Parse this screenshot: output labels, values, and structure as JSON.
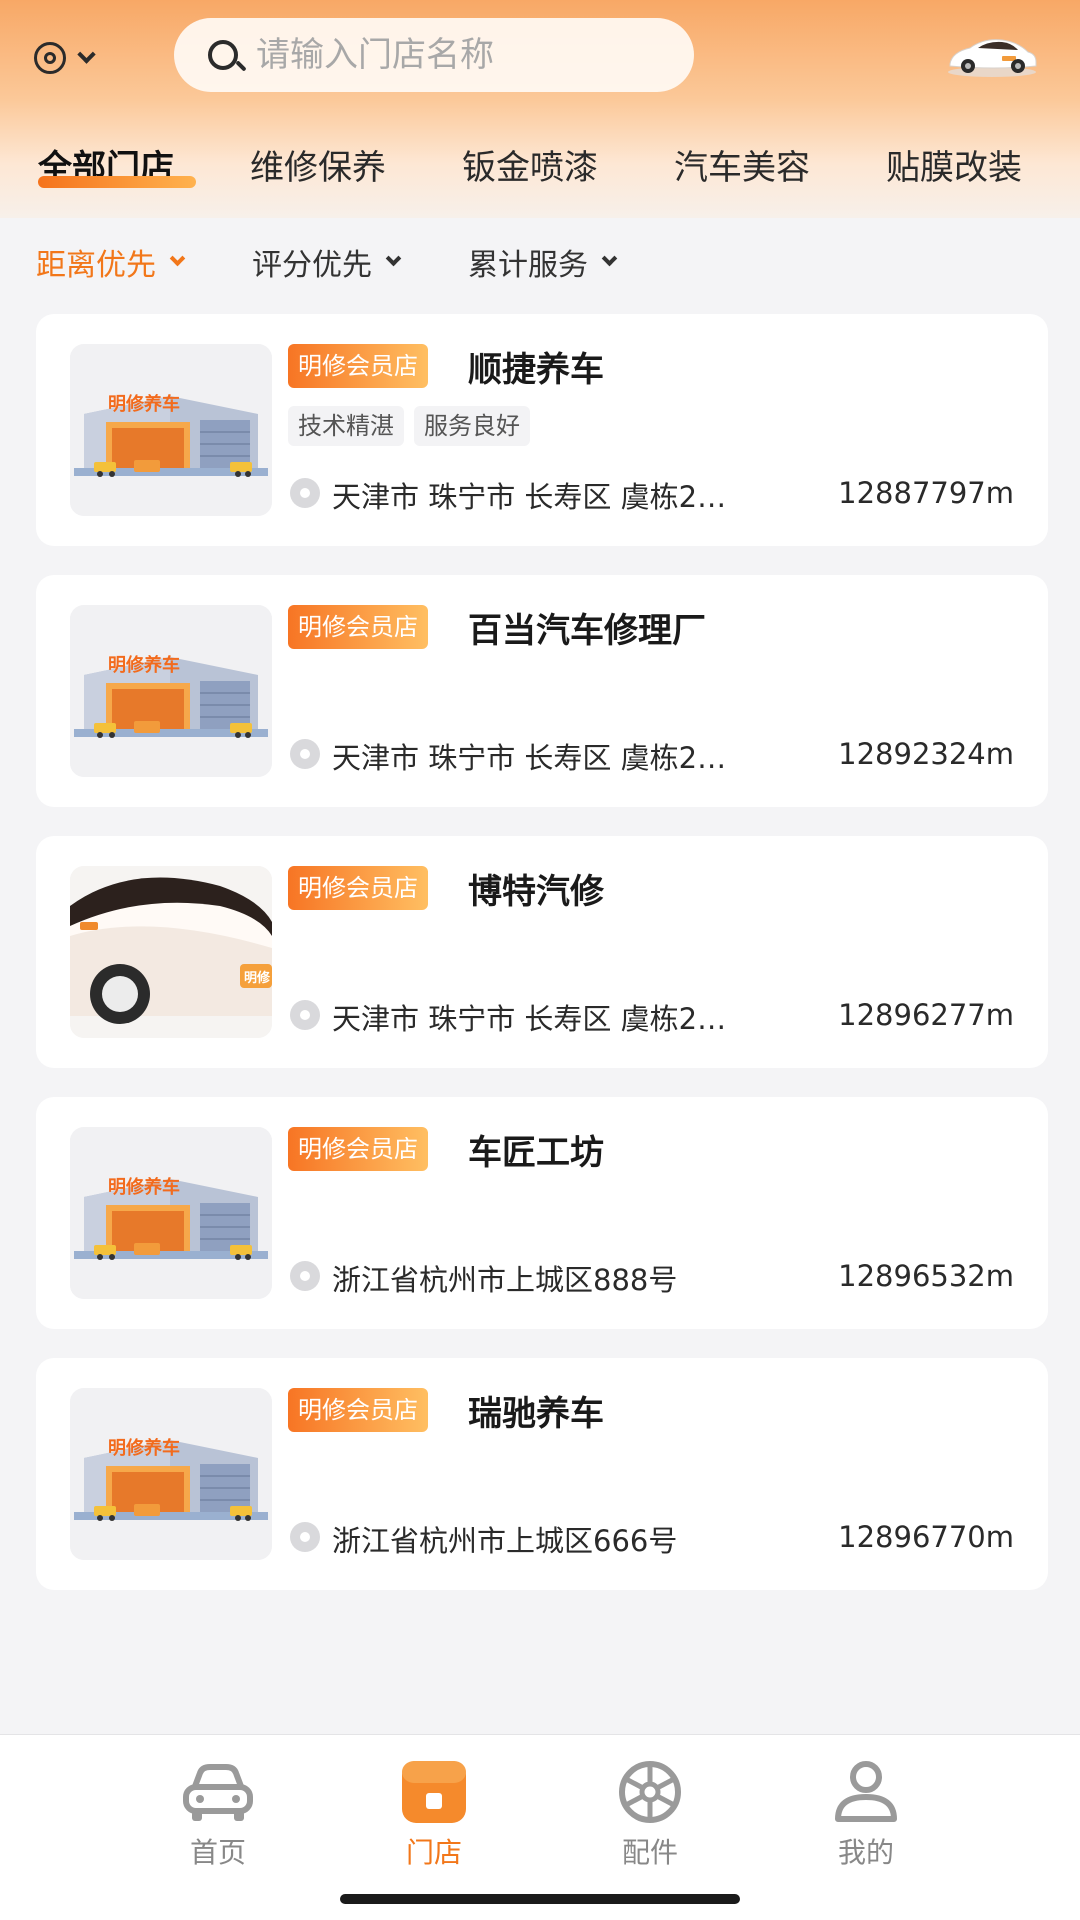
{
  "header": {
    "search_placeholder": "请输入门店名称"
  },
  "tabs": [
    {
      "label": "全部门店",
      "active": true
    },
    {
      "label": "维修保养",
      "active": false
    },
    {
      "label": "钣金喷漆",
      "active": false
    },
    {
      "label": "汽车美容",
      "active": false
    },
    {
      "label": "贴膜改装",
      "active": false
    }
  ],
  "sort": [
    {
      "label": "距离优先",
      "active": true
    },
    {
      "label": "评分优先",
      "active": false
    },
    {
      "label": "累计服务",
      "active": false
    }
  ],
  "stores": [
    {
      "badge": "明修会员店",
      "name": "顺捷养车",
      "tags": [
        "技术精湛",
        "服务良好"
      ],
      "address": "天津市 珠宁市 长寿区 虞栋2…",
      "distance": "12887797m",
      "thumb": "shop-illustration",
      "thumb_label": "明修养车"
    },
    {
      "badge": "明修会员店",
      "name": "百当汽车修理厂",
      "tags": [],
      "address": "天津市 珠宁市 长寿区 虞栋2…",
      "distance": "12892324m",
      "thumb": "shop-illustration",
      "thumb_label": "明修养车"
    },
    {
      "badge": "明修会员店",
      "name": "博特汽修",
      "tags": [],
      "address": "天津市 珠宁市 长寿区 虞栋2…",
      "distance": "12896277m",
      "thumb": "car-illustration",
      "thumb_label": "明修"
    },
    {
      "badge": "明修会员店",
      "name": "车匠工坊",
      "tags": [],
      "address": "浙江省杭州市上城区888号",
      "distance": "12896532m",
      "thumb": "shop-illustration",
      "thumb_label": "明修养车"
    },
    {
      "badge": "明修会员店",
      "name": "瑞驰养车",
      "tags": [],
      "address": "浙江省杭州市上城区666号",
      "distance": "12896770m",
      "thumb": "shop-illustration",
      "thumb_label": "明修养车"
    }
  ],
  "bottom_nav": [
    {
      "label": "首页",
      "icon": "car-icon",
      "active": false
    },
    {
      "label": "门店",
      "icon": "store-icon",
      "active": true
    },
    {
      "label": "配件",
      "icon": "wheel-icon",
      "active": false
    },
    {
      "label": "我的",
      "icon": "user-icon",
      "active": false
    }
  ],
  "colors": {
    "accent": "#f2771a",
    "badge_start": "#f77524",
    "badge_end": "#ffbf62",
    "inactive_nav": "#888888"
  }
}
